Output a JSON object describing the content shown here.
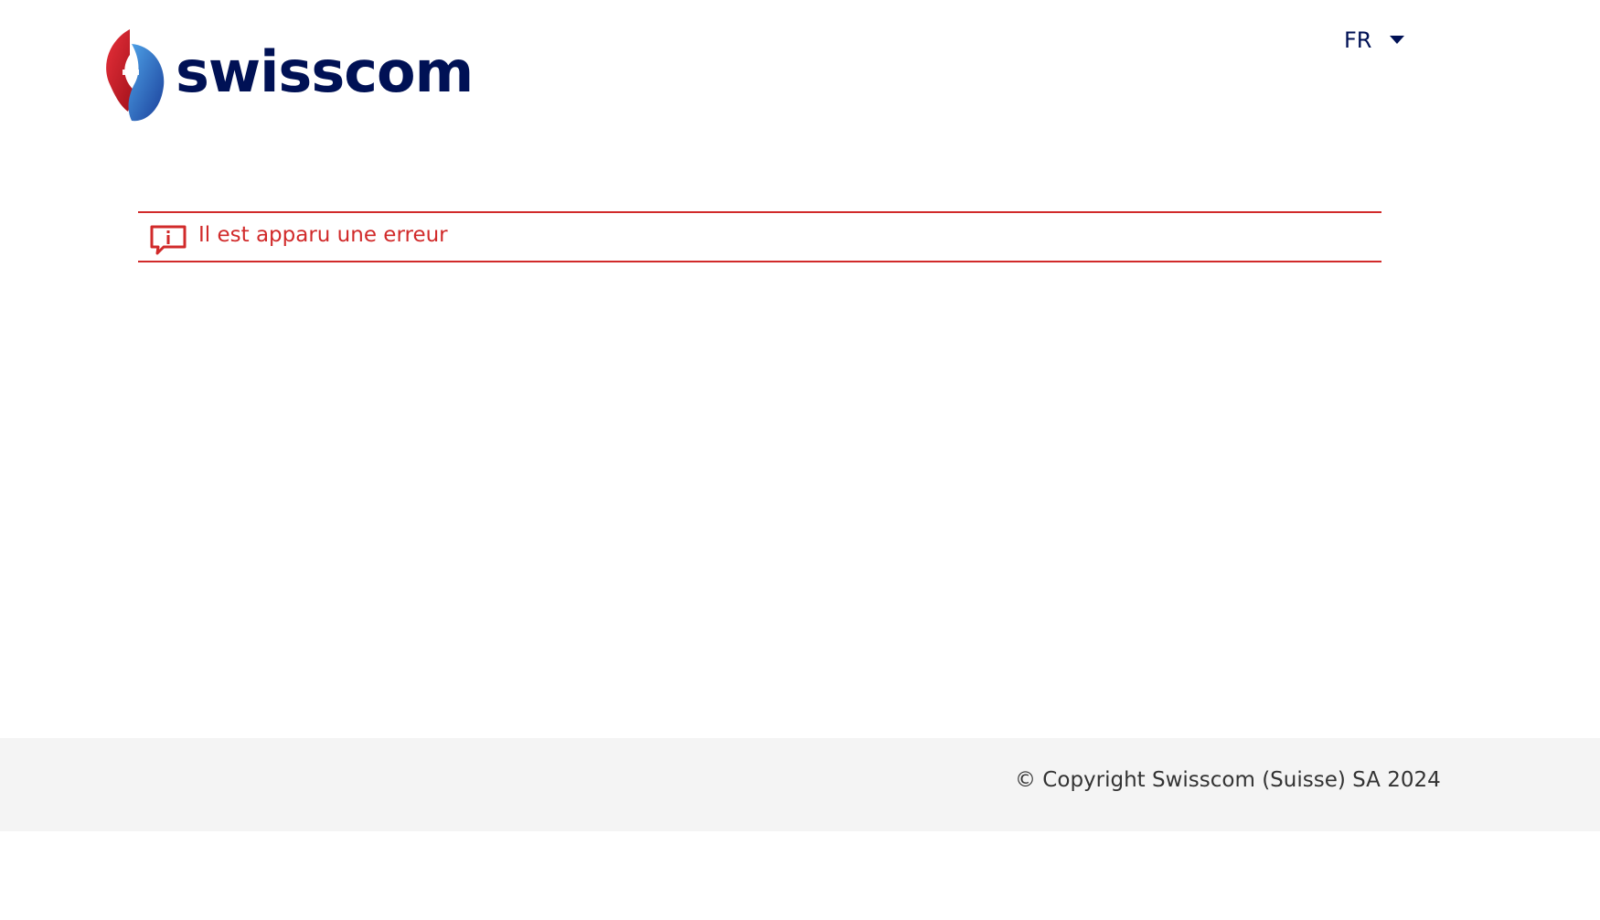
{
  "header": {
    "logo_text": "swisscom",
    "language": {
      "selected": "FR",
      "caret_icon": "caret-down-icon"
    }
  },
  "alert": {
    "icon": "info-speech-bubble-icon",
    "message": "Il est apparu une erreur",
    "color": "#d12a2a"
  },
  "footer": {
    "copyright": "© Copyright Swisscom (Suisse) SA 2024",
    "background": "#f4f4f4"
  },
  "colors": {
    "brand_navy": "#001155",
    "error_red": "#d12a2a"
  }
}
